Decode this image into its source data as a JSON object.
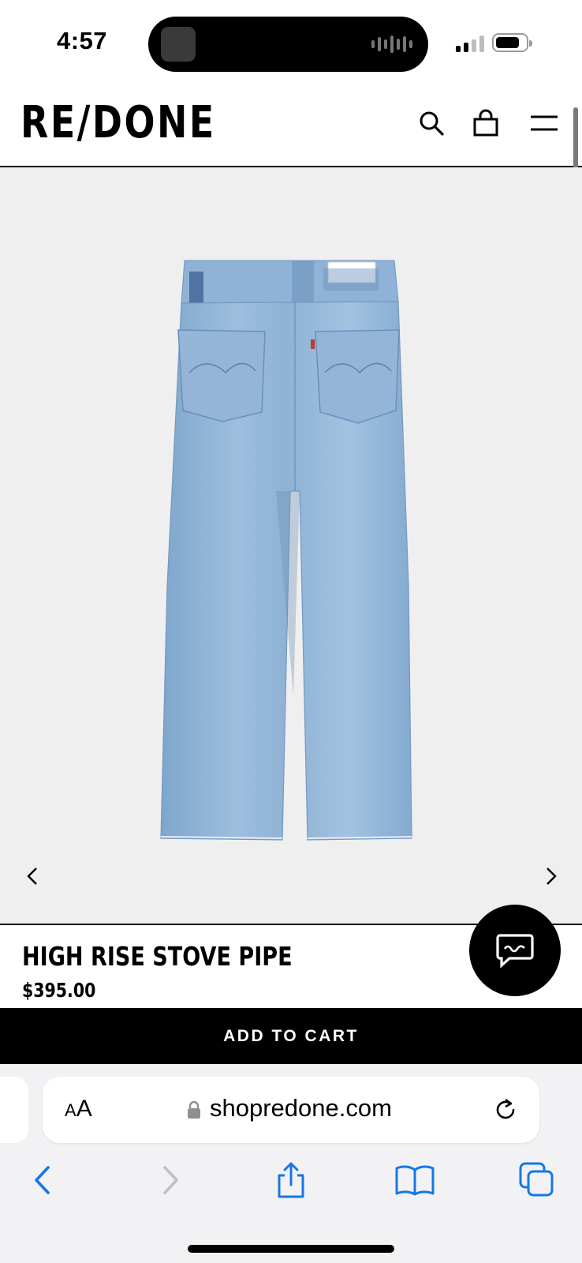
{
  "status_bar": {
    "time": "4:57",
    "signal_bars_active": 2,
    "signal_bars_total": 4,
    "battery_level": 0.8
  },
  "site": {
    "logo": "RE/DONE",
    "icons": [
      "search-icon",
      "shopping-bag-icon",
      "menu-icon"
    ]
  },
  "gallery": {
    "image": "light-wash-jeans-back-view",
    "prev_icon": "chevron-left-icon",
    "next_icon": "chevron-right-icon"
  },
  "product": {
    "name": "HIGH RISE STOVE PIPE",
    "price": "$395.00"
  },
  "chat": {
    "icon": "chat-icon"
  },
  "cart": {
    "button_label": "ADD TO CART"
  },
  "browser": {
    "text_size_label_small": "A",
    "text_size_label_large": "A",
    "url": "shopredone.com",
    "toolbar_icons": [
      "back-icon",
      "forward-icon",
      "share-icon",
      "bookmarks-icon",
      "tabs-icon"
    ]
  },
  "colors": {
    "accent_black": "#000000",
    "gallery_bg": "#f0eff0",
    "safari_blue": "#1677e6",
    "browser_bg": "#f2f2f4"
  }
}
